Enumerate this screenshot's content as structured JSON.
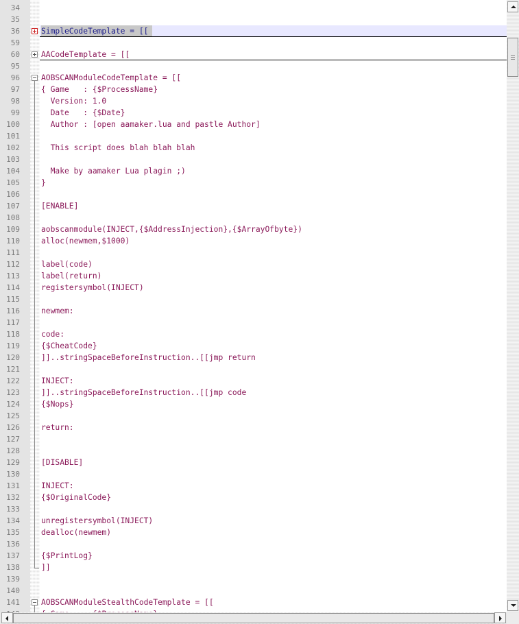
{
  "editor": {
    "lines": [
      {
        "n": "34",
        "t": ""
      },
      {
        "n": "35",
        "t": ""
      },
      {
        "n": "36",
        "t": "SimpleCodeTemplate = [[",
        "fold": "plus-red",
        "current": true,
        "foldline": true
      },
      {
        "n": "59",
        "t": ""
      },
      {
        "n": "60",
        "t": "AACodeTemplate = [[",
        "fold": "plus-grey",
        "foldline": true
      },
      {
        "n": "95",
        "t": ""
      },
      {
        "n": "96",
        "t": "AOBSCANModuleCodeTemplate = [[",
        "fold": "minus-grey"
      },
      {
        "n": "97",
        "t": "{ Game   : {$ProcessName}"
      },
      {
        "n": "98",
        "t": "  Version: 1.0"
      },
      {
        "n": "99",
        "t": "  Date   : {$Date}"
      },
      {
        "n": "100",
        "t": "  Author : [open aamaker.lua and pastle Author]"
      },
      {
        "n": "101",
        "t": ""
      },
      {
        "n": "102",
        "t": "  This script does blah blah blah"
      },
      {
        "n": "103",
        "t": ""
      },
      {
        "n": "104",
        "t": "  Make by aamaker Lua plagin ;)"
      },
      {
        "n": "105",
        "t": "}"
      },
      {
        "n": "106",
        "t": ""
      },
      {
        "n": "107",
        "t": "[ENABLE]"
      },
      {
        "n": "108",
        "t": ""
      },
      {
        "n": "109",
        "t": "aobscanmodule(INJECT,{$AddressInjection},{$ArrayOfbyte})"
      },
      {
        "n": "110",
        "t": "alloc(newmem,$1000)"
      },
      {
        "n": "111",
        "t": ""
      },
      {
        "n": "112",
        "t": "label(code)"
      },
      {
        "n": "113",
        "t": "label(return)"
      },
      {
        "n": "114",
        "t": "registersymbol(INJECT)"
      },
      {
        "n": "115",
        "t": ""
      },
      {
        "n": "116",
        "t": "newmem:"
      },
      {
        "n": "117",
        "t": ""
      },
      {
        "n": "118",
        "t": "code:"
      },
      {
        "n": "119",
        "t": "{$CheatCode}"
      },
      {
        "n": "120",
        "t": "]]..stringSpaceBeforeInstruction..[[jmp return"
      },
      {
        "n": "121",
        "t": ""
      },
      {
        "n": "122",
        "t": "INJECT:"
      },
      {
        "n": "123",
        "t": "]]..stringSpaceBeforeInstruction..[[jmp code"
      },
      {
        "n": "124",
        "t": "{$Nops}"
      },
      {
        "n": "125",
        "t": ""
      },
      {
        "n": "126",
        "t": "return:"
      },
      {
        "n": "127",
        "t": ""
      },
      {
        "n": "128",
        "t": ""
      },
      {
        "n": "129",
        "t": "[DISABLE]"
      },
      {
        "n": "130",
        "t": ""
      },
      {
        "n": "131",
        "t": "INJECT:"
      },
      {
        "n": "132",
        "t": "{$OriginalCode}"
      },
      {
        "n": "133",
        "t": ""
      },
      {
        "n": "134",
        "t": "unregistersymbol(INJECT)"
      },
      {
        "n": "135",
        "t": "dealloc(newmem)"
      },
      {
        "n": "136",
        "t": ""
      },
      {
        "n": "137",
        "t": "{$PrintLog}"
      },
      {
        "n": "138",
        "t": "]]",
        "foldend": true
      },
      {
        "n": "139",
        "t": ""
      },
      {
        "n": "140",
        "t": ""
      },
      {
        "n": "141",
        "t": "AOBSCANModuleStealthCodeTemplate = [[",
        "fold": "minus-grey"
      },
      {
        "n": "142",
        "t": "{ Game   : {$ProcessName}"
      }
    ]
  },
  "colors": {
    "text": "#8b1a5a",
    "plain_identifier": "#1a1a8a",
    "operator": "#000080",
    "current_line": "#e8e8ff",
    "fold_red": "#cc2020"
  },
  "scrollbars": {
    "vertical": {
      "up_icon": "arrow-up",
      "down_icon": "arrow-down",
      "position": 0.07
    },
    "horizontal": {
      "left_icon": "arrow-left",
      "right_icon": "arrow-right"
    }
  }
}
